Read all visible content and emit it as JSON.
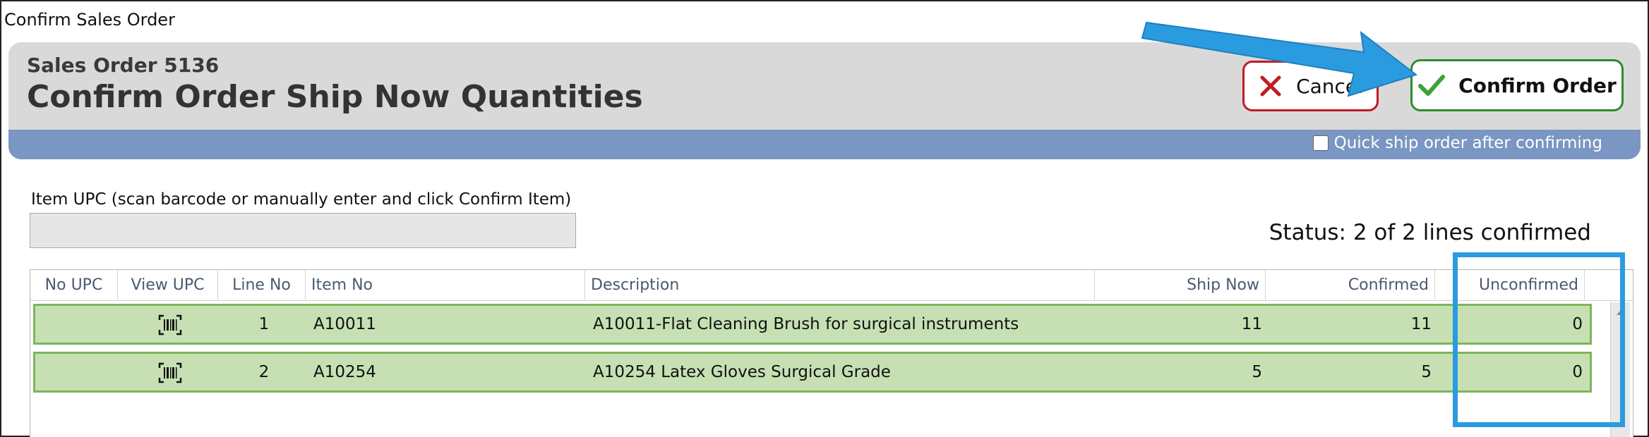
{
  "window": {
    "title": "Confirm Sales Order"
  },
  "header": {
    "sales_order": "Sales Order 5136",
    "title": "Confirm Order Ship Now Quantities"
  },
  "buttons": {
    "cancel_label": "Cancel",
    "confirm_label": "Confirm Order"
  },
  "options": {
    "quick_ship_label": "Quick ship order after confirming",
    "quick_ship_checked": false
  },
  "upc": {
    "label": "Item UPC (scan barcode or manually enter and click Confirm Item)",
    "value": ""
  },
  "status": {
    "text": "Status: 2 of 2 lines confirmed"
  },
  "grid": {
    "columns": [
      "No UPC",
      "View UPC",
      "Line No",
      "Item No",
      "Description",
      "Ship Now",
      "Confirmed",
      "Unconfirmed"
    ],
    "rows": [
      {
        "line_no": "1",
        "item_no": "A10011",
        "description": "A10011-Flat Cleaning Brush for surgical instruments",
        "ship_now": "11",
        "confirmed": "11",
        "unconfirmed": "0"
      },
      {
        "line_no": "2",
        "item_no": "A10254",
        "description": "A10254 Latex Gloves Surgical Grade",
        "ship_now": "5",
        "confirmed": "5",
        "unconfirmed": "0"
      }
    ]
  },
  "icons": {
    "cancel": "x-icon",
    "confirm": "checkmark-icon",
    "view_upc": "barcode-icon",
    "scroll_up": "triangle-up-icon"
  },
  "colors": {
    "header_bg": "#d9d9d9",
    "blue_bar": "#7a96c2",
    "row_bg": "#c6e0b4",
    "row_border": "#7cb65a",
    "cancel_border": "#c11b26",
    "confirm_border": "#2e8b2e",
    "annotation_blue": "#2b9be0"
  }
}
